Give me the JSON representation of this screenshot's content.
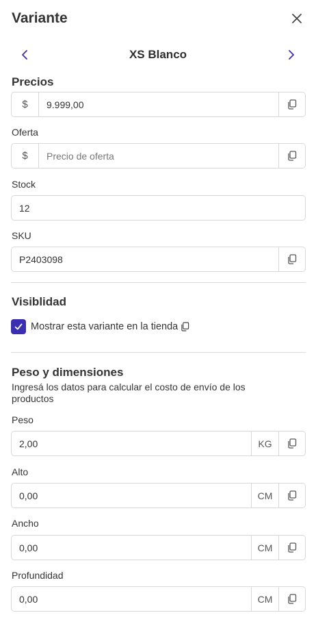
{
  "header": {
    "title": "Variante"
  },
  "nav": {
    "variant_name": "XS Blanco"
  },
  "prices": {
    "section_title": "Precios",
    "currency_symbol": "$",
    "price_value": "9.999,00",
    "offer_label": "Oferta",
    "offer_placeholder": "Precio de oferta"
  },
  "stock": {
    "label": "Stock",
    "value": "12"
  },
  "sku": {
    "label": "SKU",
    "value": "P2403098"
  },
  "visibility": {
    "section_title": "Visiblidad",
    "checkbox_label": "Mostrar esta variante en la tienda",
    "checked": true
  },
  "dimensions": {
    "section_title": "Peso y dimensiones",
    "description": "Ingresá los datos para calcular el costo de envío de los productos",
    "fields": [
      {
        "label": "Peso",
        "value": "2,00",
        "unit": "KG"
      },
      {
        "label": "Alto",
        "value": "0,00",
        "unit": "CM"
      },
      {
        "label": "Ancho",
        "value": "0,00",
        "unit": "CM"
      },
      {
        "label": "Profundidad",
        "value": "0,00",
        "unit": "CM"
      }
    ]
  },
  "icons": {
    "close": "close-icon",
    "prev": "chevron-left-icon",
    "next": "chevron-right-icon",
    "copy": "copy-icon",
    "check": "check-icon"
  },
  "colors": {
    "accent": "#3a2fb0",
    "nav_arrow": "#3a2fb0",
    "border": "#d8d8d8"
  }
}
